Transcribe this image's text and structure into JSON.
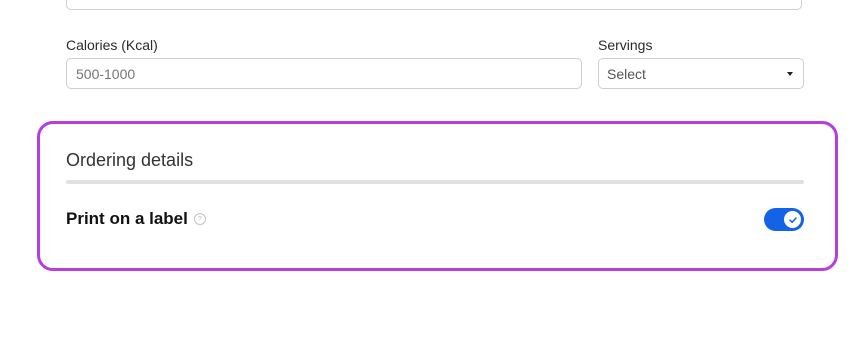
{
  "form": {
    "calories": {
      "label": "Calories (Kcal)",
      "placeholder": "500-1000",
      "value": ""
    },
    "servings": {
      "label": "Servings",
      "selected": "Select"
    }
  },
  "ordering": {
    "title": "Ordering details",
    "print_label": {
      "label": "Print on a label",
      "help_icon": "question-circle-icon",
      "enabled": true
    }
  },
  "colors": {
    "highlight_border": "#b43ee0",
    "toggle_on": "#1463e6"
  }
}
